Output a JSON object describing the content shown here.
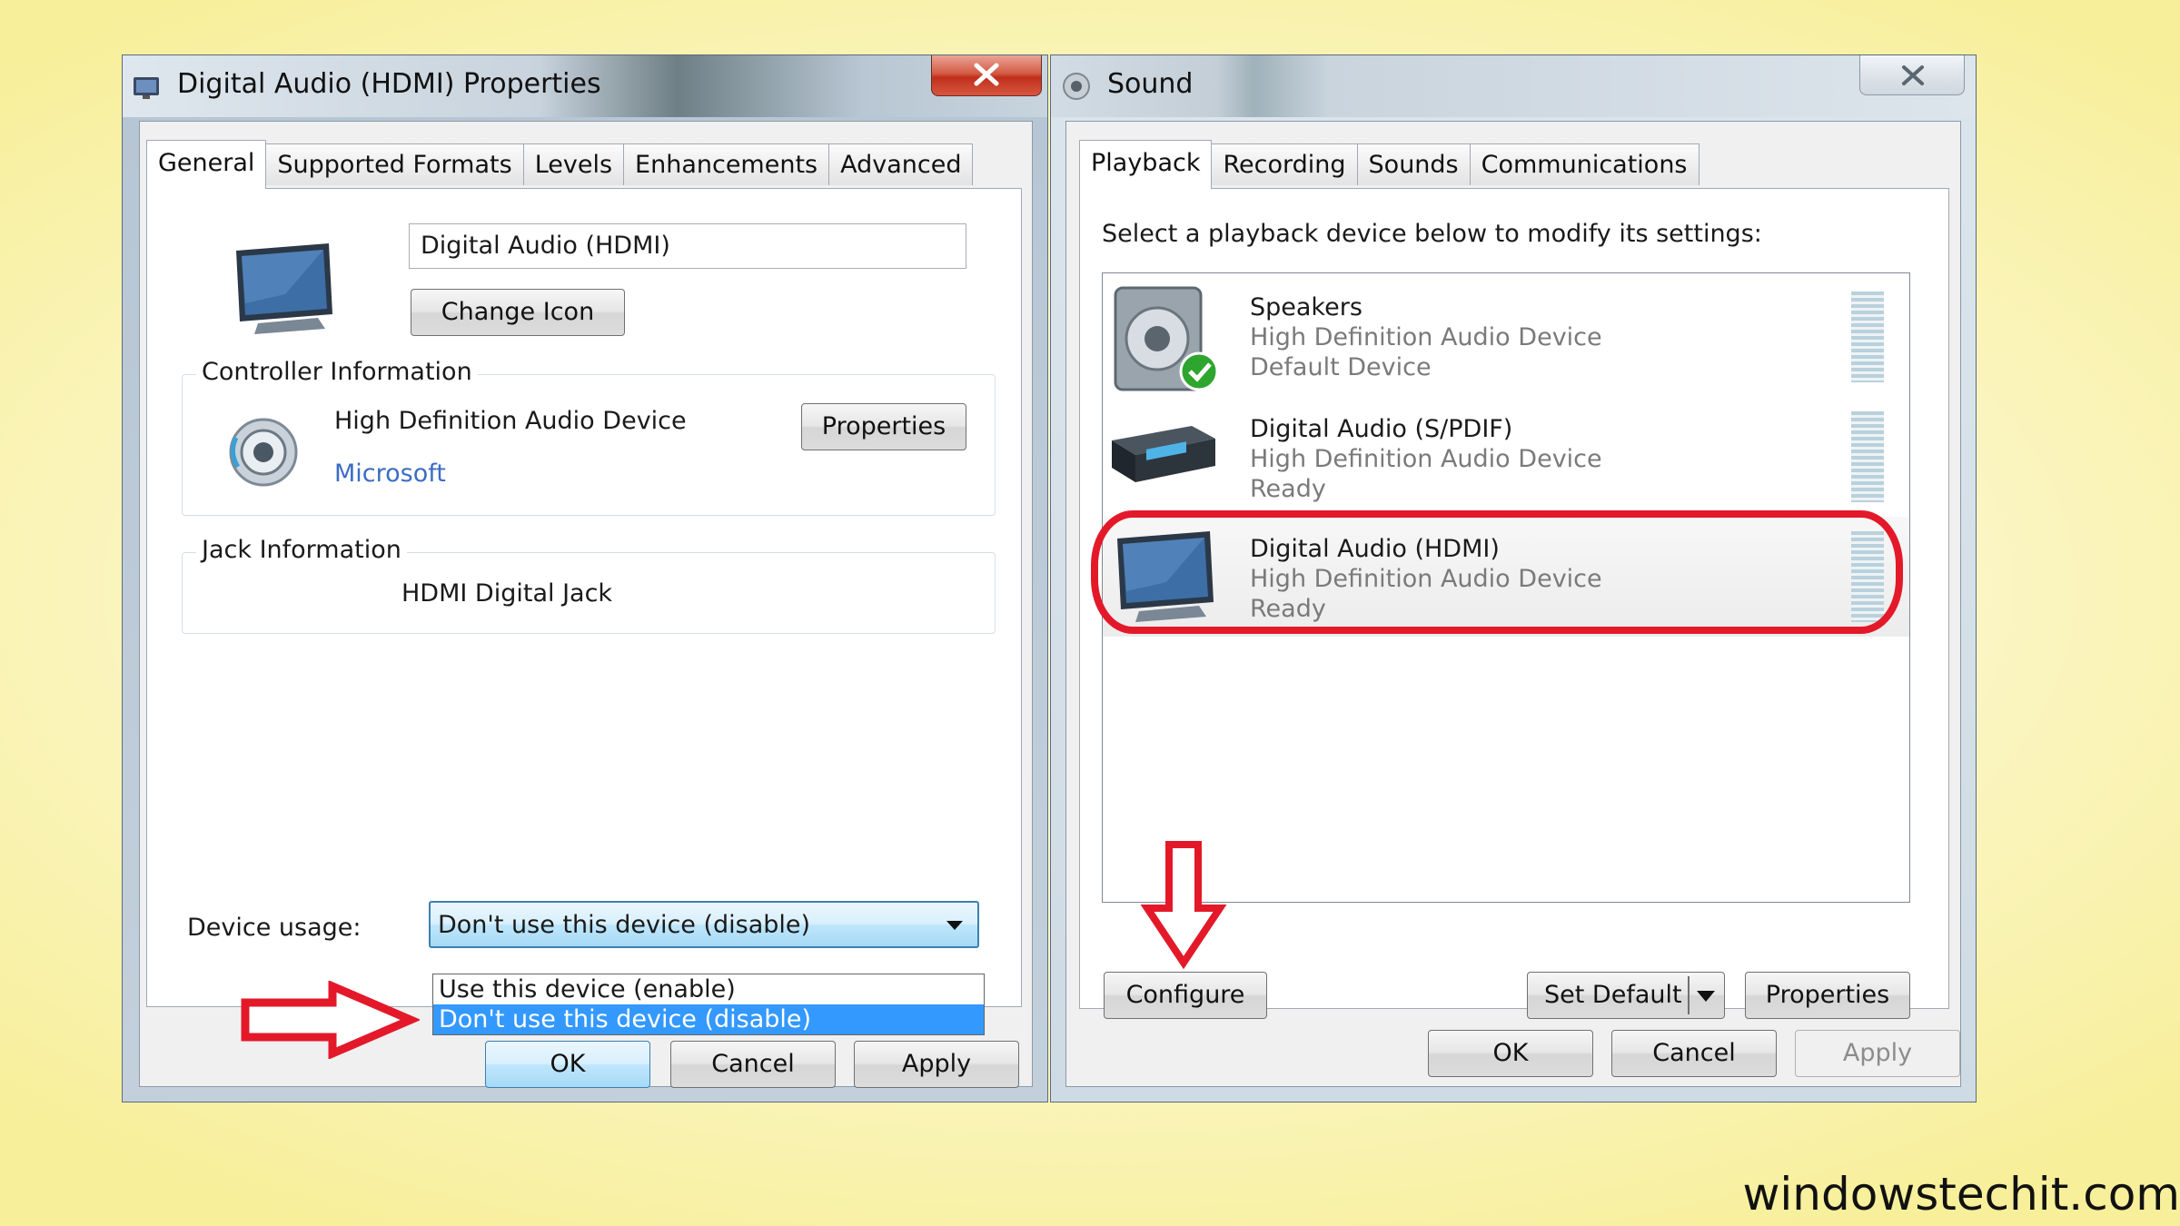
{
  "left_window": {
    "title": "Digital Audio (HDMI) Properties",
    "close_label": "X",
    "tabs": [
      "General",
      "Supported Formats",
      "Levels",
      "Enhancements",
      "Advanced"
    ],
    "device_name_value": "Digital Audio (HDMI)",
    "change_icon_label": "Change Icon",
    "controller": {
      "legend": "Controller Information",
      "name": "High Definition Audio Device",
      "vendor": "Microsoft",
      "properties_label": "Properties"
    },
    "jack": {
      "legend": "Jack Information",
      "value": "HDMI Digital Jack"
    },
    "device_usage": {
      "label": "Device usage:",
      "selected": "Don't use this device (disable)",
      "options": [
        "Use this device (enable)",
        "Don't use this device (disable)"
      ]
    },
    "buttons": {
      "ok": "OK",
      "cancel": "Cancel",
      "apply": "Apply"
    }
  },
  "right_window": {
    "title": "Sound",
    "close_label": "X",
    "tabs": [
      "Playback",
      "Recording",
      "Sounds",
      "Communications"
    ],
    "instruction": "Select a playback device below to modify its settings:",
    "devices": [
      {
        "name": "Speakers",
        "line1": "High Definition Audio Device",
        "line2": "Default Device",
        "icon": "speaker-icon"
      },
      {
        "name": "Digital Audio (S/PDIF)",
        "line1": "High Definition Audio Device",
        "line2": "Ready",
        "icon": "receiver-icon"
      },
      {
        "name": "Digital Audio (HDMI)",
        "line1": "High Definition Audio Device",
        "line2": "Ready",
        "icon": "monitor-icon"
      }
    ],
    "configure_label": "Configure",
    "set_default_label": "Set Default",
    "properties_label": "Properties",
    "buttons": {
      "ok": "OK",
      "cancel": "Cancel",
      "apply": "Apply"
    }
  },
  "watermark": "windowstechit.com",
  "colors": {
    "highlight_red": "#e3192a",
    "selection_blue": "#3399ff",
    "link_blue": "#3b6cc4"
  }
}
